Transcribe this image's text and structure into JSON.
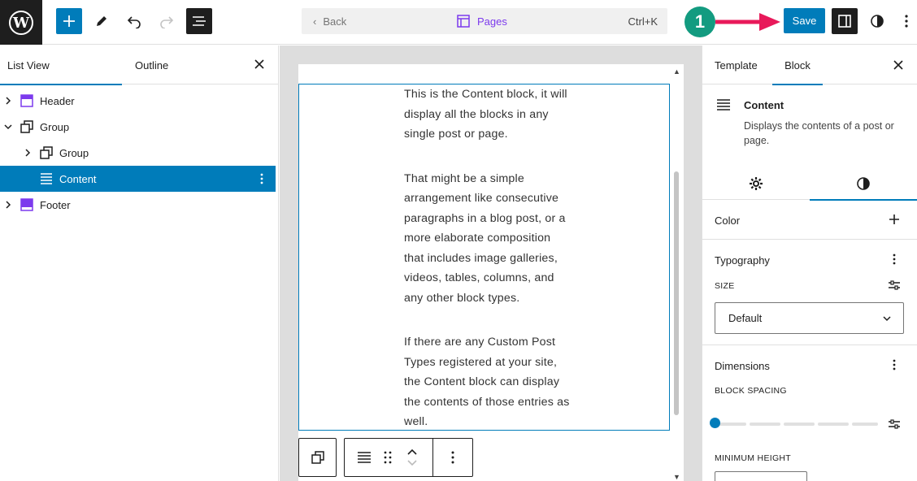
{
  "topbar": {
    "back_label": "Back",
    "command_center_label": "Pages",
    "shortcut": "Ctrl+K",
    "step_number": "1",
    "save_label": "Save",
    "colors": {
      "accent": "#007cba",
      "step_badge": "#139b80",
      "arrow": "#e8195a",
      "command_center": "#7c3aed"
    }
  },
  "left_panel": {
    "tabs": [
      {
        "label": "List View",
        "active": true
      },
      {
        "label": "Outline",
        "active": false
      }
    ],
    "tree": [
      {
        "label": "Header",
        "icon": "template-part-header-icon",
        "depth": 0,
        "expanded": false
      },
      {
        "label": "Group",
        "icon": "group-icon",
        "depth": 0,
        "expanded": true
      },
      {
        "label": "Group",
        "icon": "group-icon",
        "depth": 1,
        "expanded": false
      },
      {
        "label": "Content",
        "icon": "post-content-icon",
        "depth": 1,
        "selected": true
      },
      {
        "label": "Footer",
        "icon": "template-part-footer-icon",
        "depth": 0,
        "expanded": false
      }
    ]
  },
  "canvas": {
    "paragraphs": [
      "This is the Content block, it will display all the blocks in any single post or page.",
      "That might be a simple arrangement like consecutive paragraphs in a blog post, or a more elaborate composition that includes image galleries, videos, tables, columns, and any other block types.",
      "If there are any Custom Post Types registered at your site, the Content block can display the contents of those entries as well."
    ]
  },
  "right_panel": {
    "tabs": [
      {
        "label": "Template",
        "active": false
      },
      {
        "label": "Block",
        "active": true
      }
    ],
    "block": {
      "title": "Content",
      "description": "Displays the contents of a post or page."
    },
    "sections": {
      "color": {
        "title": "Color"
      },
      "typography": {
        "title": "Typography",
        "size_label": "SIZE",
        "size_value": "Default"
      },
      "dimensions": {
        "title": "Dimensions",
        "block_spacing_label": "BLOCK SPACING",
        "min_height_label": "MINIMUM HEIGHT"
      }
    }
  }
}
